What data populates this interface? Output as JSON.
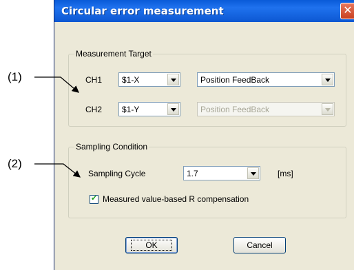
{
  "dialog": {
    "title": "Circular error measurement",
    "close_label": "✕"
  },
  "measurement_target": {
    "group_label": "Measurement Target",
    "ch1_label": "CH1",
    "ch1_axis": "$1-X",
    "ch1_type": "Position FeedBack",
    "ch2_label": "CH2",
    "ch2_axis": "$1-Y",
    "ch2_type": "Position FeedBack"
  },
  "sampling_condition": {
    "group_label": "Sampling Condition",
    "cycle_label": "Sampling Cycle",
    "cycle_value": "1.7",
    "unit": "[ms]",
    "r_comp_label": "Measured value-based R compensation",
    "r_comp_checked": true
  },
  "buttons": {
    "ok": "OK",
    "cancel": "Cancel"
  },
  "callouts": {
    "one": "(1)",
    "two": "(2)"
  }
}
